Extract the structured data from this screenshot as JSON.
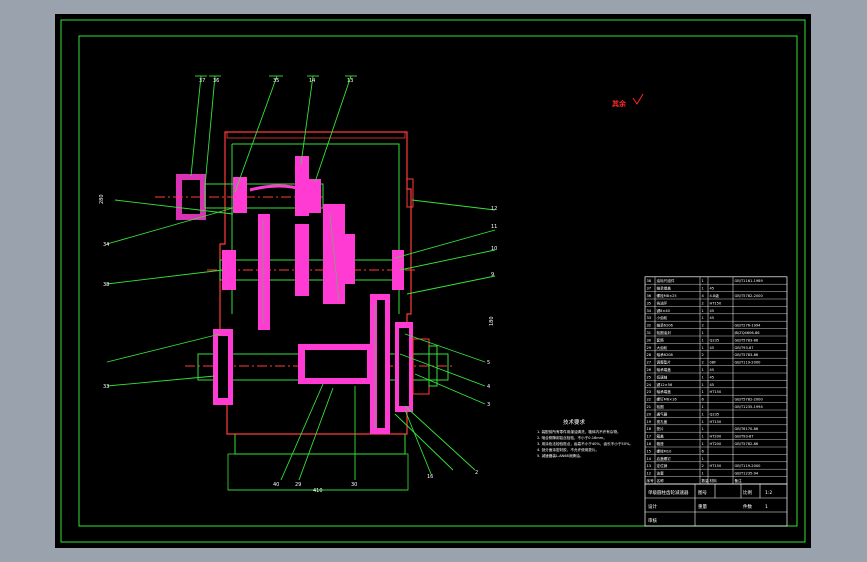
{
  "drawing": {
    "title_stamp": "其余",
    "dimension_bottom": "410",
    "dimension_left": "280",
    "dimension_right": "180"
  },
  "callouts": {
    "top": [
      "37",
      "36",
      "35",
      "14",
      "13"
    ],
    "right": [
      "12",
      "11",
      "10",
      "9",
      "5",
      "4",
      "3",
      "2"
    ],
    "left": [
      "34",
      "38",
      "33"
    ],
    "bottom": [
      "40",
      "29",
      "30",
      "16"
    ]
  },
  "notes": {
    "title": "技术要求",
    "lines": [
      "1. 装配前所有零件用煤油清洗，箱体内不许有杂物。",
      "2. 啮合侧隙用铅丝检验，不小于0.16mm。",
      "3. 用涂色法检验斑点，齿高不小于40%，齿长不小于50%。",
      "4. 剖分面涂密封胶，不允许使用垫片。",
      "5. 减速器装L-AN68润滑油。"
    ]
  },
  "bom": {
    "rows": [
      {
        "no": "38",
        "name": "油标尺组件",
        "qty": "1",
        "material": "",
        "std": "GB/T1161-1989"
      },
      {
        "no": "37",
        "name": "轴承端盖",
        "qty": "1",
        "material": "45",
        "std": ""
      },
      {
        "no": "36",
        "name": "螺栓M8×25",
        "qty": "4",
        "material": "4.8级",
        "std": "GB/T5782-2000"
      },
      {
        "no": "35",
        "name": "挡油环",
        "qty": "2",
        "material": "HT150",
        "std": ""
      },
      {
        "no": "34",
        "name": "键8×40",
        "qty": "1",
        "material": "45",
        "std": ""
      },
      {
        "no": "33",
        "name": "小齿轮",
        "qty": "1",
        "material": "45",
        "std": ""
      },
      {
        "no": "32",
        "name": "轴承6206",
        "qty": "2",
        "material": "",
        "std": "GB/T276-1994"
      },
      {
        "no": "31",
        "name": "毡圈油封",
        "qty": "1",
        "material": "",
        "std": "JB/ZQ4606-86"
      },
      {
        "no": "30",
        "name": "套筒",
        "qty": "1",
        "material": "Q235",
        "std": "GB/T5783-86"
      },
      {
        "no": "29",
        "name": "大齿轮",
        "qty": "1",
        "material": "45",
        "std": "GB/T93-87"
      },
      {
        "no": "28",
        "name": "轴承6208",
        "qty": "2",
        "material": "",
        "std": "GB/T5783-86"
      },
      {
        "no": "27",
        "name": "调整垫片",
        "qty": "2",
        "material": "08F",
        "std": "GB/T119-2000"
      },
      {
        "no": "26",
        "name": "轴承端盖",
        "qty": "1",
        "material": "45",
        "std": ""
      },
      {
        "no": "25",
        "name": "低速轴",
        "qty": "1",
        "material": "45",
        "std": ""
      },
      {
        "no": "24",
        "name": "键12×56",
        "qty": "1",
        "material": "45",
        "std": ""
      },
      {
        "no": "23",
        "name": "轴承端盖",
        "qty": "1",
        "material": "HT150",
        "std": ""
      },
      {
        "no": "22",
        "name": "螺钉M6×16",
        "qty": "6",
        "material": "",
        "std": "GB/T5782-2000"
      },
      {
        "no": "21",
        "name": "毡圈",
        "qty": "1",
        "material": "",
        "std": "GB/T1235-1994"
      },
      {
        "no": "20",
        "name": "通气器",
        "qty": "1",
        "material": "Q235",
        "std": ""
      },
      {
        "no": "19",
        "name": "视孔盖",
        "qty": "1",
        "material": "HT150",
        "std": ""
      },
      {
        "no": "18",
        "name": "垫片",
        "qty": "1",
        "material": "",
        "std": "GB/T6170-86"
      },
      {
        "no": "17",
        "name": "箱盖",
        "qty": "1",
        "material": "HT200",
        "std": "GB/T93-87"
      },
      {
        "no": "16",
        "name": "箱座",
        "qty": "1",
        "material": "HT200",
        "std": "GB/T5782-86"
      },
      {
        "no": "15",
        "name": "螺栓M10",
        "qty": "6",
        "material": "",
        "std": ""
      },
      {
        "no": "14",
        "name": "启盖螺钉",
        "qty": "1",
        "material": "",
        "std": ""
      },
      {
        "no": "13",
        "name": "定位销",
        "qty": "2",
        "material": "HT150",
        "std": "GB/T119-2000"
      },
      {
        "no": "12",
        "name": "油塞",
        "qty": "1",
        "material": "",
        "std": "GB/T1235-94"
      }
    ],
    "header": {
      "no": "序号",
      "name": "名称",
      "qty": "数量",
      "material": "材料",
      "std": "备注"
    }
  },
  "title_block": {
    "name": "单级圆柱齿轮减速器",
    "scale_label": "比例",
    "scale": "1:2",
    "sheet_label": "图号",
    "weight_label": "重量",
    "qty_label": "件数",
    "qty": "1",
    "designer_label": "设计",
    "checker_label": "审核",
    "approver_label": "批准"
  }
}
